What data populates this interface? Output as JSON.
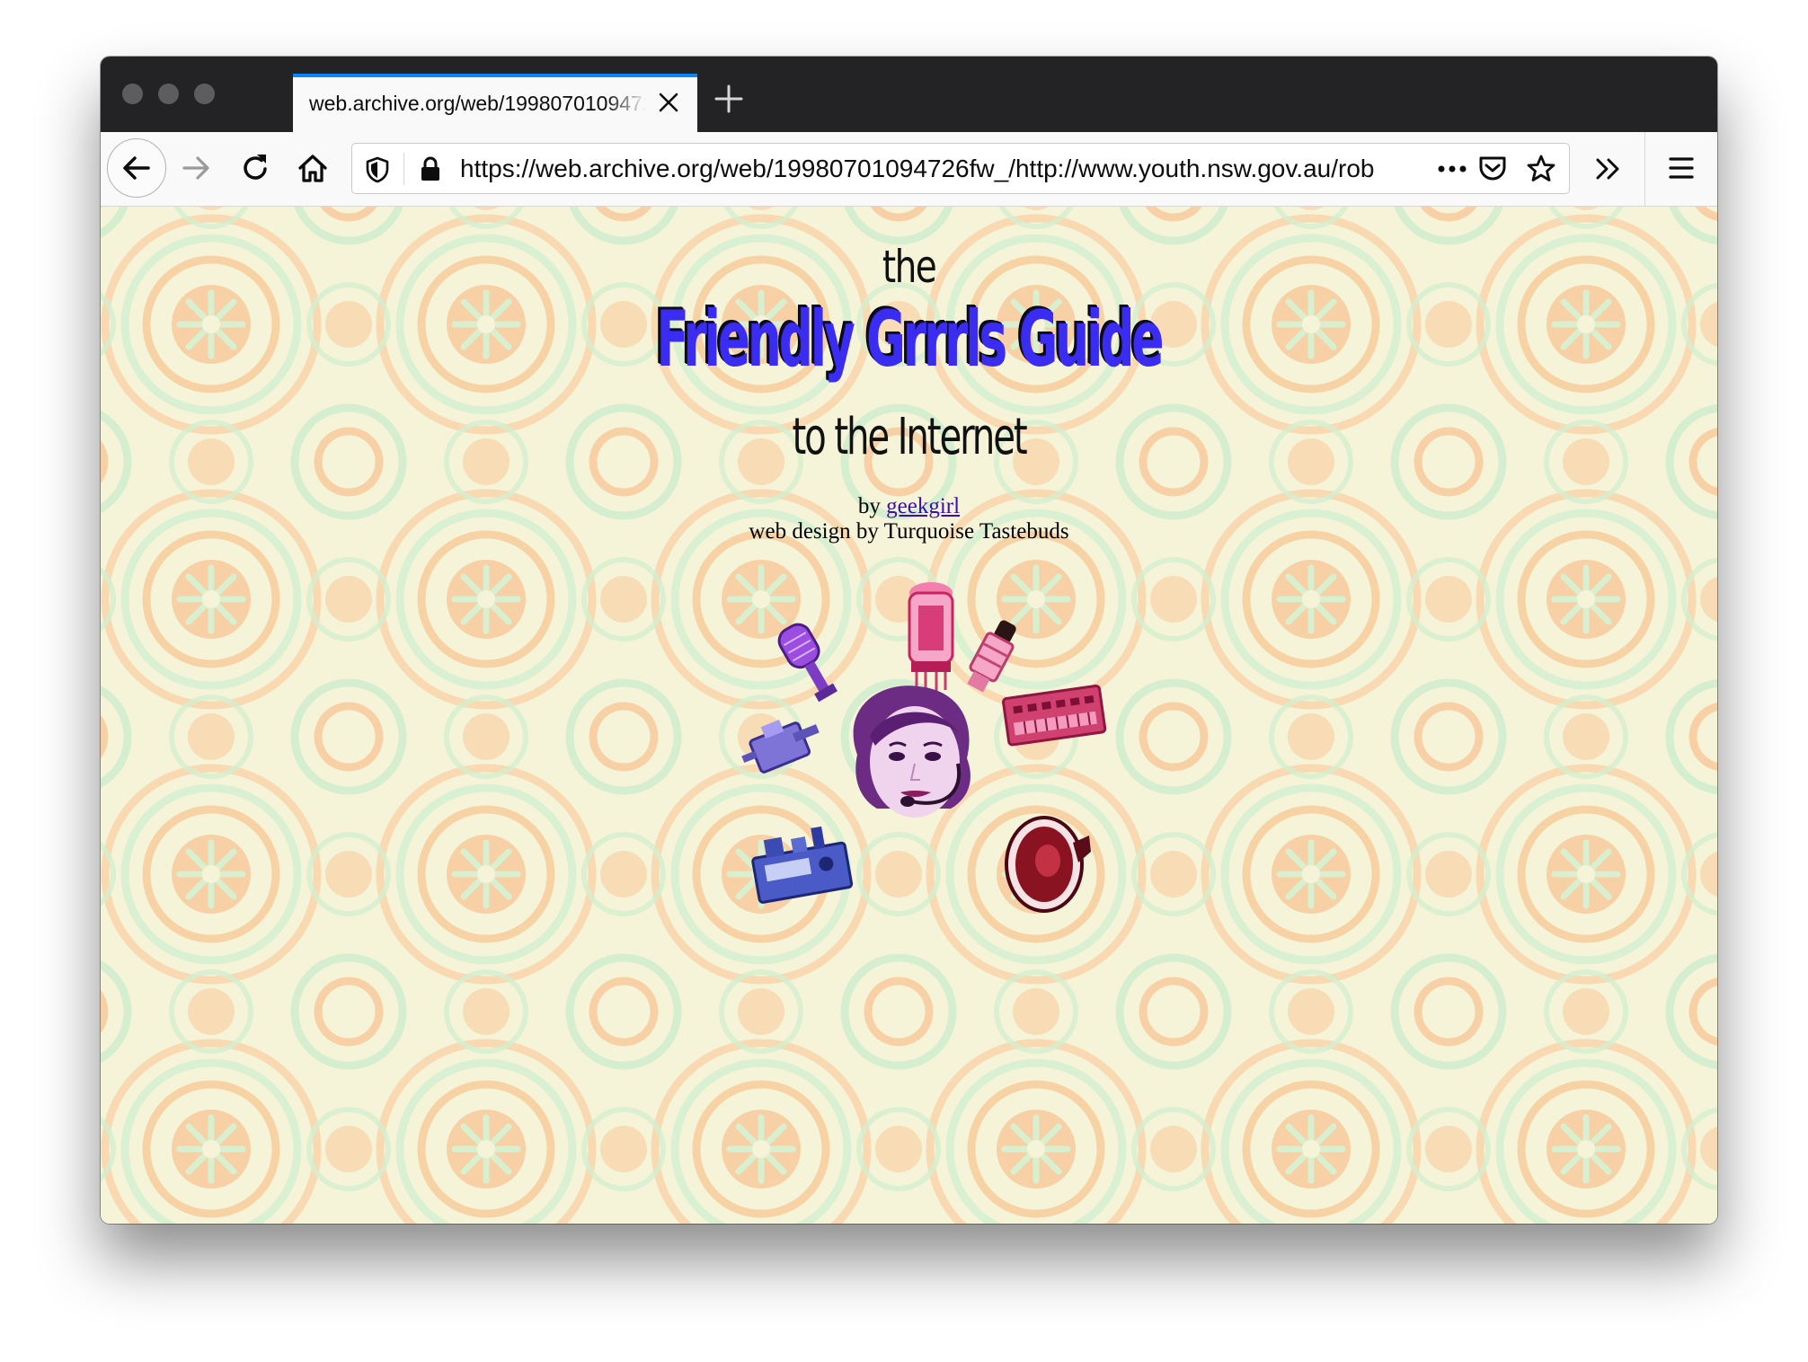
{
  "browser": {
    "tab_title": "web.archive.org/web/1998070109472",
    "url": "https://web.archive.org/web/19980701094726fw_/http://www.youth.nsw.gov.au/rob"
  },
  "page": {
    "heading_the": "the",
    "heading_main": "Friendly Grrrls Guide",
    "heading_sub": "to the Internet",
    "by_prefix": "by",
    "author_link": "geekgirl",
    "design_credit": "web design by Turquoise Tastebuds"
  },
  "colors": {
    "tab_accent": "#0a84ff",
    "title_blue": "#3a2cf0",
    "link_purple": "#3a10a8",
    "pattern_orange": "#f6c79a",
    "pattern_green": "#cdeed0"
  }
}
